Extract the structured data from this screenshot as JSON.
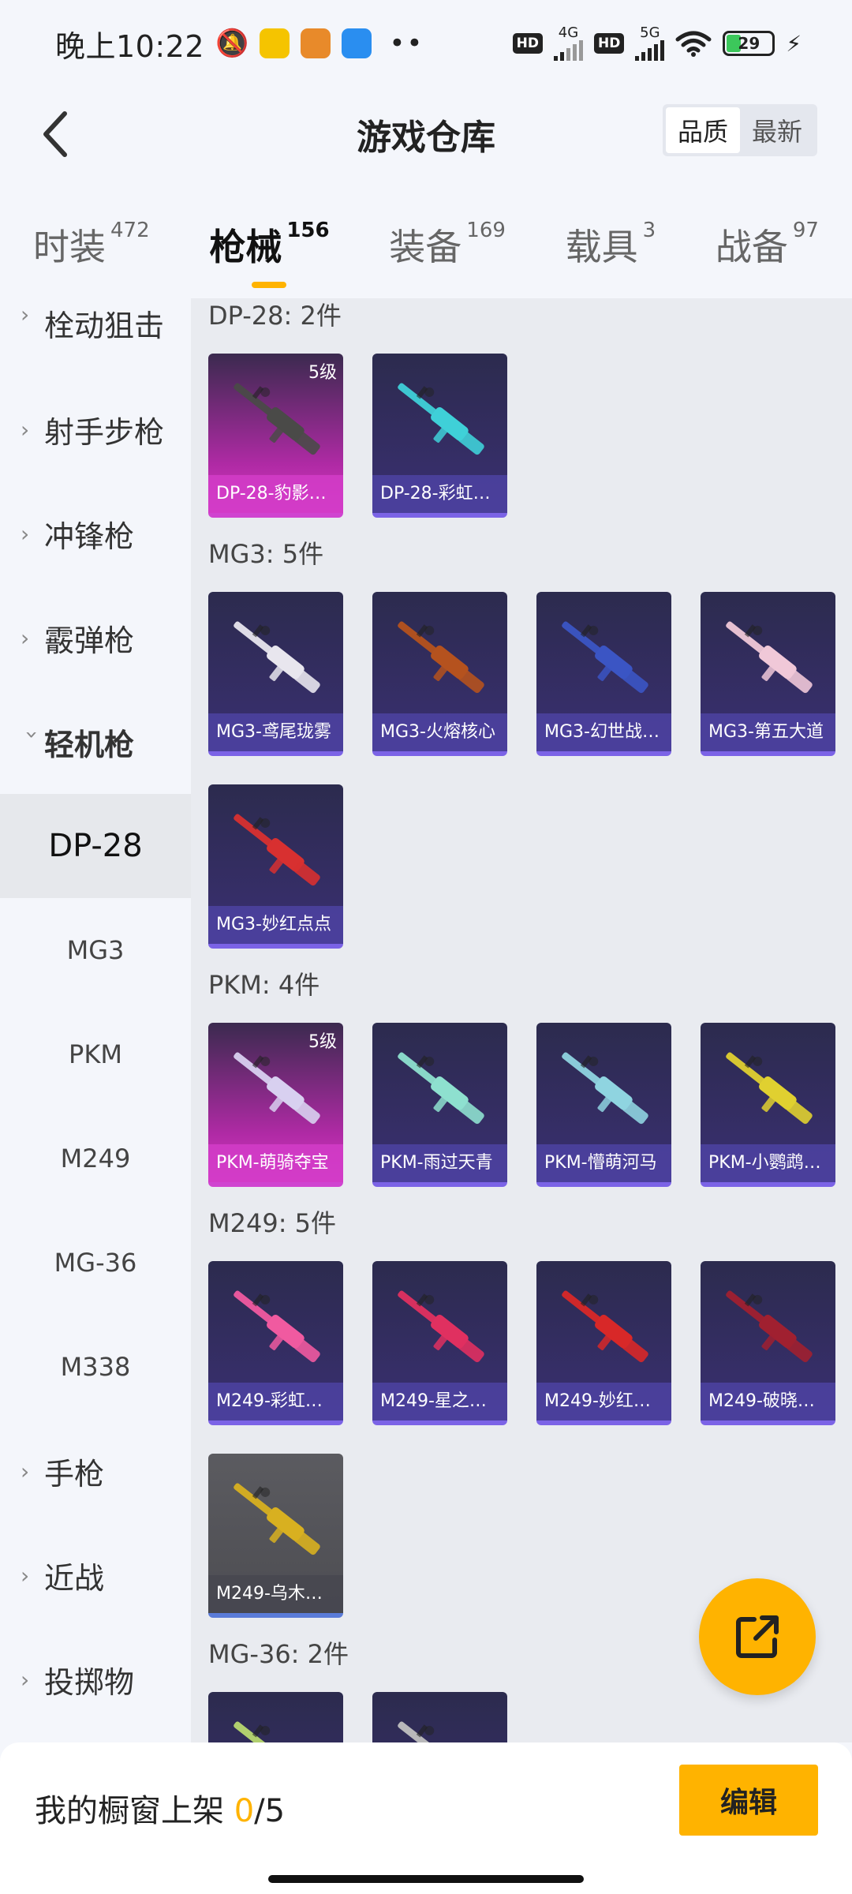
{
  "status_bar": {
    "time": "晚上10:22",
    "net1": "4G",
    "net2": "5G",
    "hd": "HD",
    "battery": "29",
    "colors": {
      "battery_fill": "#3cc75b"
    }
  },
  "header": {
    "title": "游戏仓库",
    "sort_options": [
      "品质",
      "最新"
    ],
    "sort_selected": "品质"
  },
  "tabs": [
    {
      "label": "时装",
      "count": "472"
    },
    {
      "label": "枪械",
      "count": "156"
    },
    {
      "label": "装备",
      "count": "169"
    },
    {
      "label": "载具",
      "count": "3"
    },
    {
      "label": "战备",
      "count": "97"
    }
  ],
  "active_tab": "枪械",
  "sidebar": {
    "categories_top": [
      "栓动狙击",
      "射手步枪",
      "冲锋枪",
      "霰弹枪"
    ],
    "expanded_category": "轻机枪",
    "subcategories": [
      "DP-28",
      "MG3",
      "PKM",
      "M249",
      "MG-36",
      "M338"
    ],
    "active_subcategory": "DP-28",
    "categories_bottom": [
      "手枪",
      "近战",
      "投掷物"
    ]
  },
  "groups": [
    {
      "title": "DP-28: 2件",
      "items": [
        {
          "name": "DP-28-豹影…",
          "level": "5级",
          "rarity": "gold",
          "gun_color": "#4a4a48"
        },
        {
          "name": "DP-28-彩虹…",
          "level": "",
          "rarity": "purple",
          "gun_color": "#3fd0d8"
        }
      ]
    },
    {
      "title": "MG3: 5件",
      "items": [
        {
          "name": "MG3-鸢尾珑雾",
          "level": "",
          "rarity": "purple",
          "gun_color": "#e8e6ee"
        },
        {
          "name": "MG3-火熔核心",
          "level": "",
          "rarity": "purple",
          "gun_color": "#b5521e"
        },
        {
          "name": "MG3-幻世战…",
          "level": "",
          "rarity": "purple",
          "gun_color": "#3b55c4"
        },
        {
          "name": "MG3-第五大道",
          "level": "",
          "rarity": "purple",
          "gun_color": "#f0c8d8"
        },
        {
          "name": "MG3-妙红点点",
          "level": "",
          "rarity": "purple",
          "gun_color": "#d83030"
        }
      ]
    },
    {
      "title": "PKM: 4件",
      "items": [
        {
          "name": "PKM-萌骑夺宝",
          "level": "5级",
          "rarity": "gold",
          "gun_color": "#d8d0f0"
        },
        {
          "name": "PKM-雨过天青",
          "level": "",
          "rarity": "purple",
          "gun_color": "#8ee0cf"
        },
        {
          "name": "PKM-懵萌河马",
          "level": "",
          "rarity": "purple",
          "gun_color": "#8fd4e0"
        },
        {
          "name": "PKM-小鹦鹉…",
          "level": "",
          "rarity": "purple",
          "gun_color": "#e0d030"
        }
      ]
    },
    {
      "title": "M249: 5件",
      "items": [
        {
          "name": "M249-彩虹…",
          "level": "",
          "rarity": "purple",
          "gun_color": "#f05aa0"
        },
        {
          "name": "M249-星之…",
          "level": "",
          "rarity": "purple",
          "gun_color": "#e03060"
        },
        {
          "name": "M249-妙红…",
          "level": "",
          "rarity": "purple",
          "gun_color": "#d82828"
        },
        {
          "name": "M249-破晓…",
          "level": "",
          "rarity": "purple",
          "gun_color": "#a02030"
        },
        {
          "name": "M249-乌木…",
          "level": "",
          "rarity": "grey",
          "gun_color": "#d8b020"
        }
      ]
    },
    {
      "title": "MG-36: 2件",
      "items": [
        {
          "name": "",
          "level": "",
          "rarity": "purple",
          "gun_color": "#b8d870"
        },
        {
          "name": "",
          "level": "",
          "rarity": "purple",
          "gun_color": "#c0c0c0"
        }
      ]
    }
  ],
  "bottom_bar": {
    "label": "我的橱窗上架",
    "current": "0",
    "total": "/5",
    "edit_label": "编辑"
  }
}
